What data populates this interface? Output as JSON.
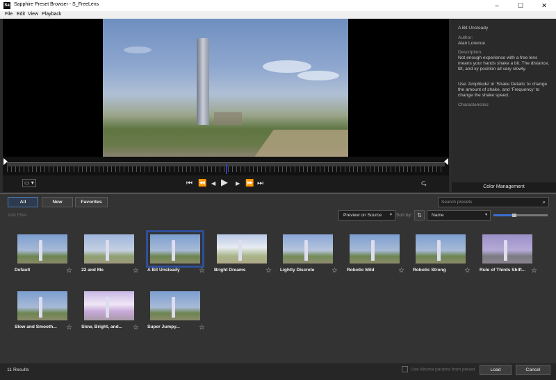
{
  "window": {
    "title": "Sapphire Preset Browser - S_FreeLens",
    "icon_label": "Sa",
    "minimize": "–",
    "maximize": "☐",
    "close": "✕"
  },
  "menu": [
    "File",
    "Edit",
    "View",
    "Playback"
  ],
  "transport": {
    "to_start": "⏮",
    "step_back_fast": "⏪",
    "step_back": "◀",
    "play": "▶",
    "step_forward": "▶",
    "step_forward_fast": "⏩",
    "to_end": "⏭",
    "loop": "⮎",
    "aspect": "▭ ▾",
    "playhead_position": 0.5
  },
  "info": {
    "preset_name": "A Bit Unsteady",
    "author_label": "Author:",
    "author": "Alan Lorence",
    "description_label": "Description:",
    "description_1": "Not enough experience with a free lens means your hands shake a bit. The distance, tilt, and xy position all vary slowly.",
    "description_2": "Use 'Amplitude' in 'Shake Details' to change the amount of shake, and 'Frequency' to change the shake speed.",
    "characteristics_label": "Characteristics:"
  },
  "color_management": "Color Management",
  "tabs": [
    "All",
    "New",
    "Favorites"
  ],
  "active_tab": "All",
  "search": {
    "placeholder": "Search presets",
    "icon": "🔍"
  },
  "add_filter": "Add Filter",
  "preview_mode": "Preview on Source",
  "sort_label": "Sort by:",
  "sort_icon": "⇅",
  "sort_value": "Name",
  "thumb_size": 0.38,
  "presets": [
    {
      "name": "Default",
      "star": "☆"
    },
    {
      "name": "22 and Me",
      "star": "☆"
    },
    {
      "name": "A Bit Unsteady",
      "star": "☆"
    },
    {
      "name": "Bright Dreams",
      "star": "☆"
    },
    {
      "name": "Lightly Discrete",
      "star": "☆"
    },
    {
      "name": "Robotic Mild",
      "star": "☆"
    },
    {
      "name": "Robotic Strong",
      "star": "☆"
    },
    {
      "name": "Rule of Thirds Shift...",
      "star": "☆"
    },
    {
      "name": "Slow and Smooth...",
      "star": "☆"
    },
    {
      "name": "Slow, Bright, and...",
      "star": "☆"
    },
    {
      "name": "Super Jumpy...",
      "star": "☆"
    }
  ],
  "selected_preset": "A Bit Unsteady",
  "status": {
    "results": "11 Results",
    "mocha_label": "Use Mocha params from preset",
    "load": "Load",
    "cancel": "Cancel"
  },
  "colors": {
    "accent": "#3b6fd0",
    "selection": "#2f4f9a",
    "bg": "#333333"
  }
}
